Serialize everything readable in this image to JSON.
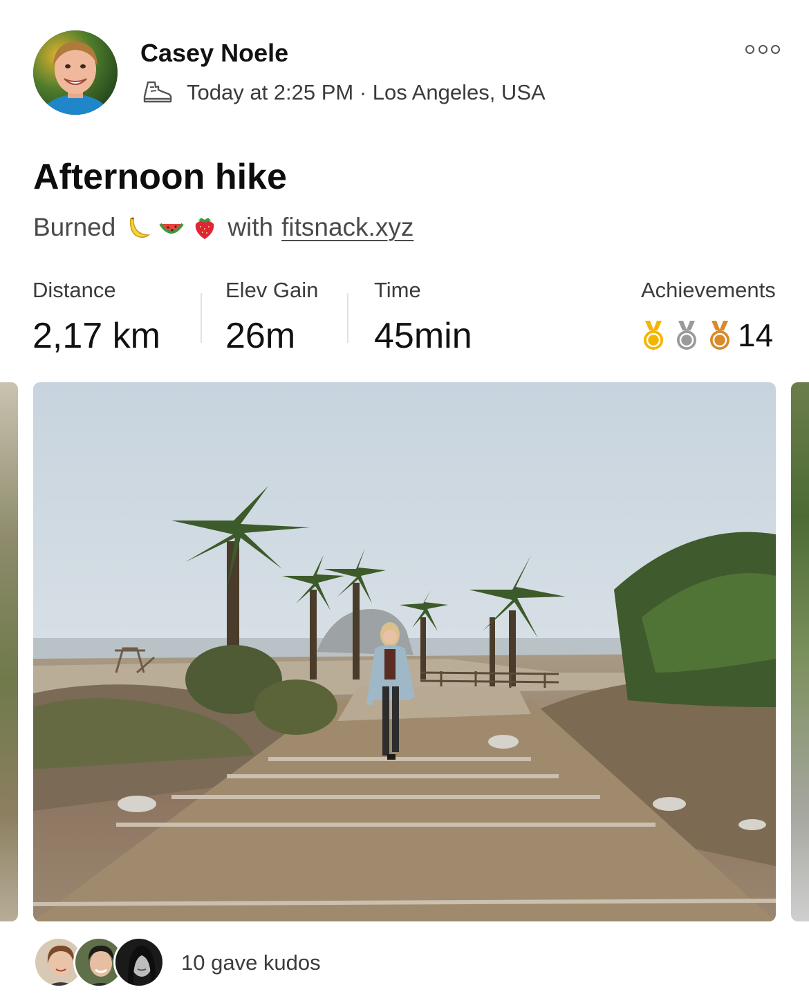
{
  "athlete": {
    "name": "Casey Noele",
    "activity_icon": "hiking-shoe-icon",
    "meta": "Today at 2:25 PM · Los Angeles, USA"
  },
  "menu_icon": "more-options-icon",
  "activity": {
    "title": "Afternoon hike",
    "burned_prefix": "Burned",
    "fruit_icons": [
      "banana-icon",
      "watermelon-icon",
      "strawberry-icon"
    ],
    "burned_with": "with",
    "link_text": "fitsnack.xyz"
  },
  "stats": [
    {
      "label": "Distance",
      "value": "2,17 km"
    },
    {
      "label": "Elev Gain",
      "value": "26m"
    },
    {
      "label": "Time",
      "value": "45min"
    }
  ],
  "achievements": {
    "label": "Achievements",
    "medals": [
      "gold-medal-icon",
      "silver-medal-icon",
      "bronze-medal-icon"
    ],
    "count": "14"
  },
  "photo": {
    "description_icon": "hike-photo"
  },
  "kudos": {
    "avatars": [
      "kudo-avatar-1",
      "kudo-avatar-2",
      "kudo-avatar-3"
    ],
    "text": "10 gave kudos"
  },
  "colors": {
    "gold": "#f5b400",
    "silver": "#9a9a9a",
    "bronze": "#d98a2b",
    "text_primary": "#111111",
    "text_secondary": "#3b3b3b"
  }
}
